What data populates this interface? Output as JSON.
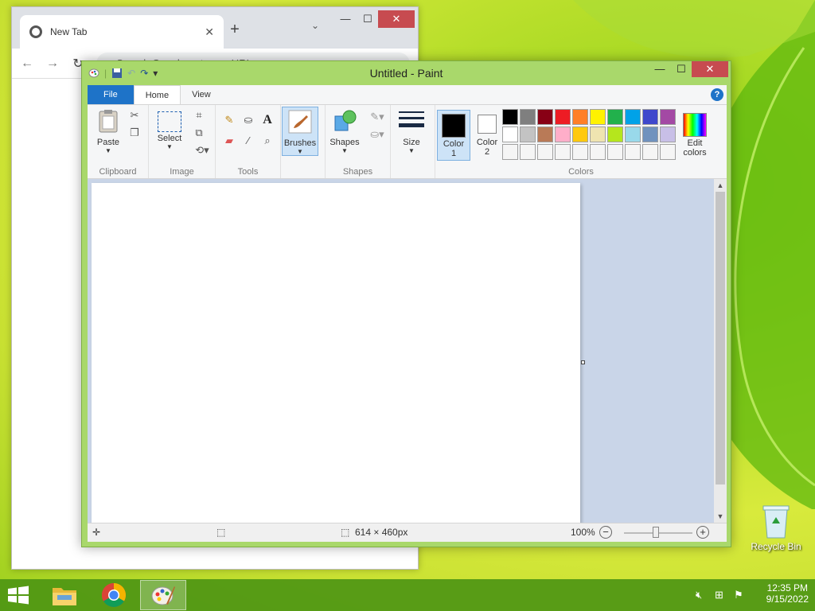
{
  "desktop": {
    "recycle_bin_label": "Recycle Bin"
  },
  "chrome": {
    "tab_title": "New Tab",
    "tab_close": "✕",
    "new_tab": "+",
    "tab_dropdown": "⌄",
    "minimize": "—",
    "maximize": "☐",
    "close": "✕",
    "back": "←",
    "forward": "→",
    "reload": "↻",
    "omnibox_placeholder": "Search Google or type a URL",
    "share": "⇪",
    "star": "☆",
    "sidepanel": "▮",
    "profile": "●",
    "menu": "⋮"
  },
  "paint": {
    "title": "Untitled - Paint",
    "minimize": "—",
    "maximize": "☐",
    "close": "✕",
    "tabs": {
      "file": "File",
      "home": "Home",
      "view": "View"
    },
    "help": "?",
    "groups": {
      "clipboard": {
        "label": "Clipboard",
        "paste": "Paste"
      },
      "image": {
        "label": "Image",
        "select": "Select"
      },
      "tools": {
        "label": "Tools"
      },
      "brushes": {
        "label": "Brushes"
      },
      "shapes": {
        "label": "Shapes",
        "button": "Shapes"
      },
      "size": {
        "label": "Size"
      },
      "colors": {
        "label": "Colors",
        "color1": "Color\n1",
        "color1_line1": "Color",
        "color1_line2": "1",
        "color2_line1": "Color",
        "color2_line2": "2",
        "edit_line1": "Edit",
        "edit_line2": "colors"
      }
    },
    "colors": {
      "color1": "#000000",
      "color2": "#ffffff",
      "row1": [
        "#000000",
        "#7f7f7f",
        "#880015",
        "#ed1c24",
        "#ff7f27",
        "#fff200",
        "#22b14c",
        "#00a2e8",
        "#3f48cc",
        "#a349a4"
      ],
      "row2": [
        "#ffffff",
        "#c3c3c3",
        "#b97a57",
        "#ffaec9",
        "#ffc90e",
        "#efe4b0",
        "#b5e61d",
        "#99d9ea",
        "#7092be",
        "#c8bfe7"
      ],
      "row3": [
        "#f5f5f5",
        "#f5f5f5",
        "#f5f5f5",
        "#f5f5f5",
        "#f5f5f5",
        "#f5f5f5",
        "#f5f5f5",
        "#f5f5f5",
        "#f5f5f5",
        "#f5f5f5"
      ]
    },
    "status": {
      "dimensions": "614 × 460px",
      "zoom": "100%"
    }
  },
  "taskbar": {
    "time": "12:35 PM",
    "date": "9/15/2022"
  }
}
